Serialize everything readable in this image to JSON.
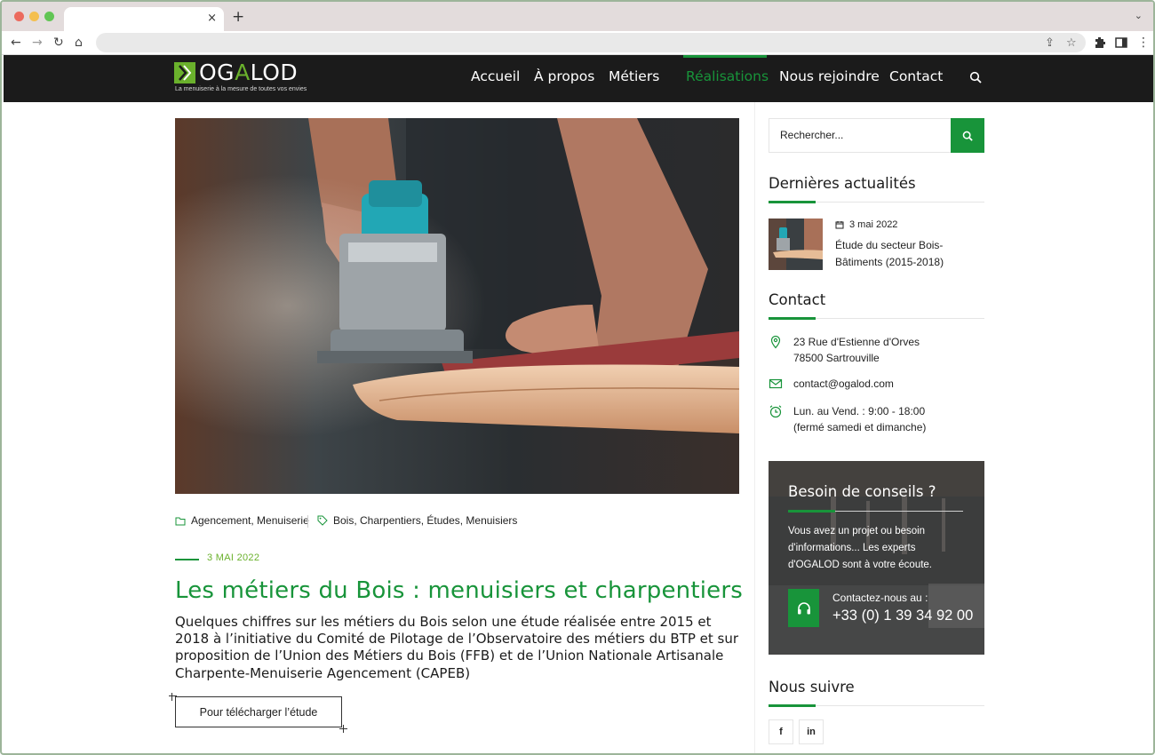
{
  "browser": {
    "tab_close": "×",
    "new_tab": "+",
    "back_icon": "←",
    "forward_icon": "→",
    "reload_icon": "↻",
    "home_icon": "⌂",
    "tab_menu": "⌄",
    "share_icon": "⇪",
    "star_icon": "☆",
    "menu_icon": "⋮"
  },
  "header": {
    "logo_text_1": "OG",
    "logo_text_accent": "A",
    "logo_text_2": "LOD",
    "tagline": "La menuiserie à la mesure de toutes vos envies",
    "menu": [
      {
        "label": "Accueil"
      },
      {
        "label": "À propos"
      },
      {
        "label": "Métiers"
      },
      {
        "label": "Réalisations"
      },
      {
        "label": "Nous rejoindre"
      },
      {
        "label": "Contact"
      }
    ],
    "active_index": 3
  },
  "post": {
    "categories": "Agencement, Menuiserie",
    "tags": "Bois, Charpentiers, Études, Menuisiers",
    "date": "3 MAI 2022",
    "title": "Les métiers du Bois : menuisiers et charpentiers",
    "excerpt": "Quelques chiffres sur les métiers du Bois selon une étude réalisée entre 2015 et 2018 à l’initiative du Comité de Pilotage de l’Observatoire des métiers du BTP et sur proposition de l’Union des Métiers du Bois (FFB) et de l’Union Nationale Artisanale Charpente-Menuiserie Agencement (CAPEB)",
    "download_label": "Pour télécharger l’étude"
  },
  "sidebar": {
    "search_placeholder": "Rechercher...",
    "latest_title": "Dernières actualités",
    "latest_item": {
      "date": "3 mai 2022",
      "title": "Étude du secteur Bois-Bâtiments (2015-2018)"
    },
    "contact_title": "Contact",
    "address_line1": "23 Rue d'Estienne d'Orves",
    "address_line2": "78500 Sartrouville",
    "email": "contact@ogalod.com",
    "hours_line1": "Lun. au Vend. : 9:00 - 18:00",
    "hours_line2": "(fermé samedi et dimanche)",
    "advice": {
      "title": "Besoin de conseils ?",
      "text": "Vous avez un projet ou besoin d'informations... Les experts d'OGALOD sont à votre écoute.",
      "label": "Contactez-nous au :",
      "phone": "+33 (0) 1 39 34 92 00"
    },
    "follow_title": "Nous suivre",
    "social": [
      {
        "label": "f"
      },
      {
        "label": "in"
      }
    ]
  },
  "colors": {
    "brand_green": "#18943a",
    "lime": "#6ab12c",
    "header_bg": "#1b1b1b"
  }
}
